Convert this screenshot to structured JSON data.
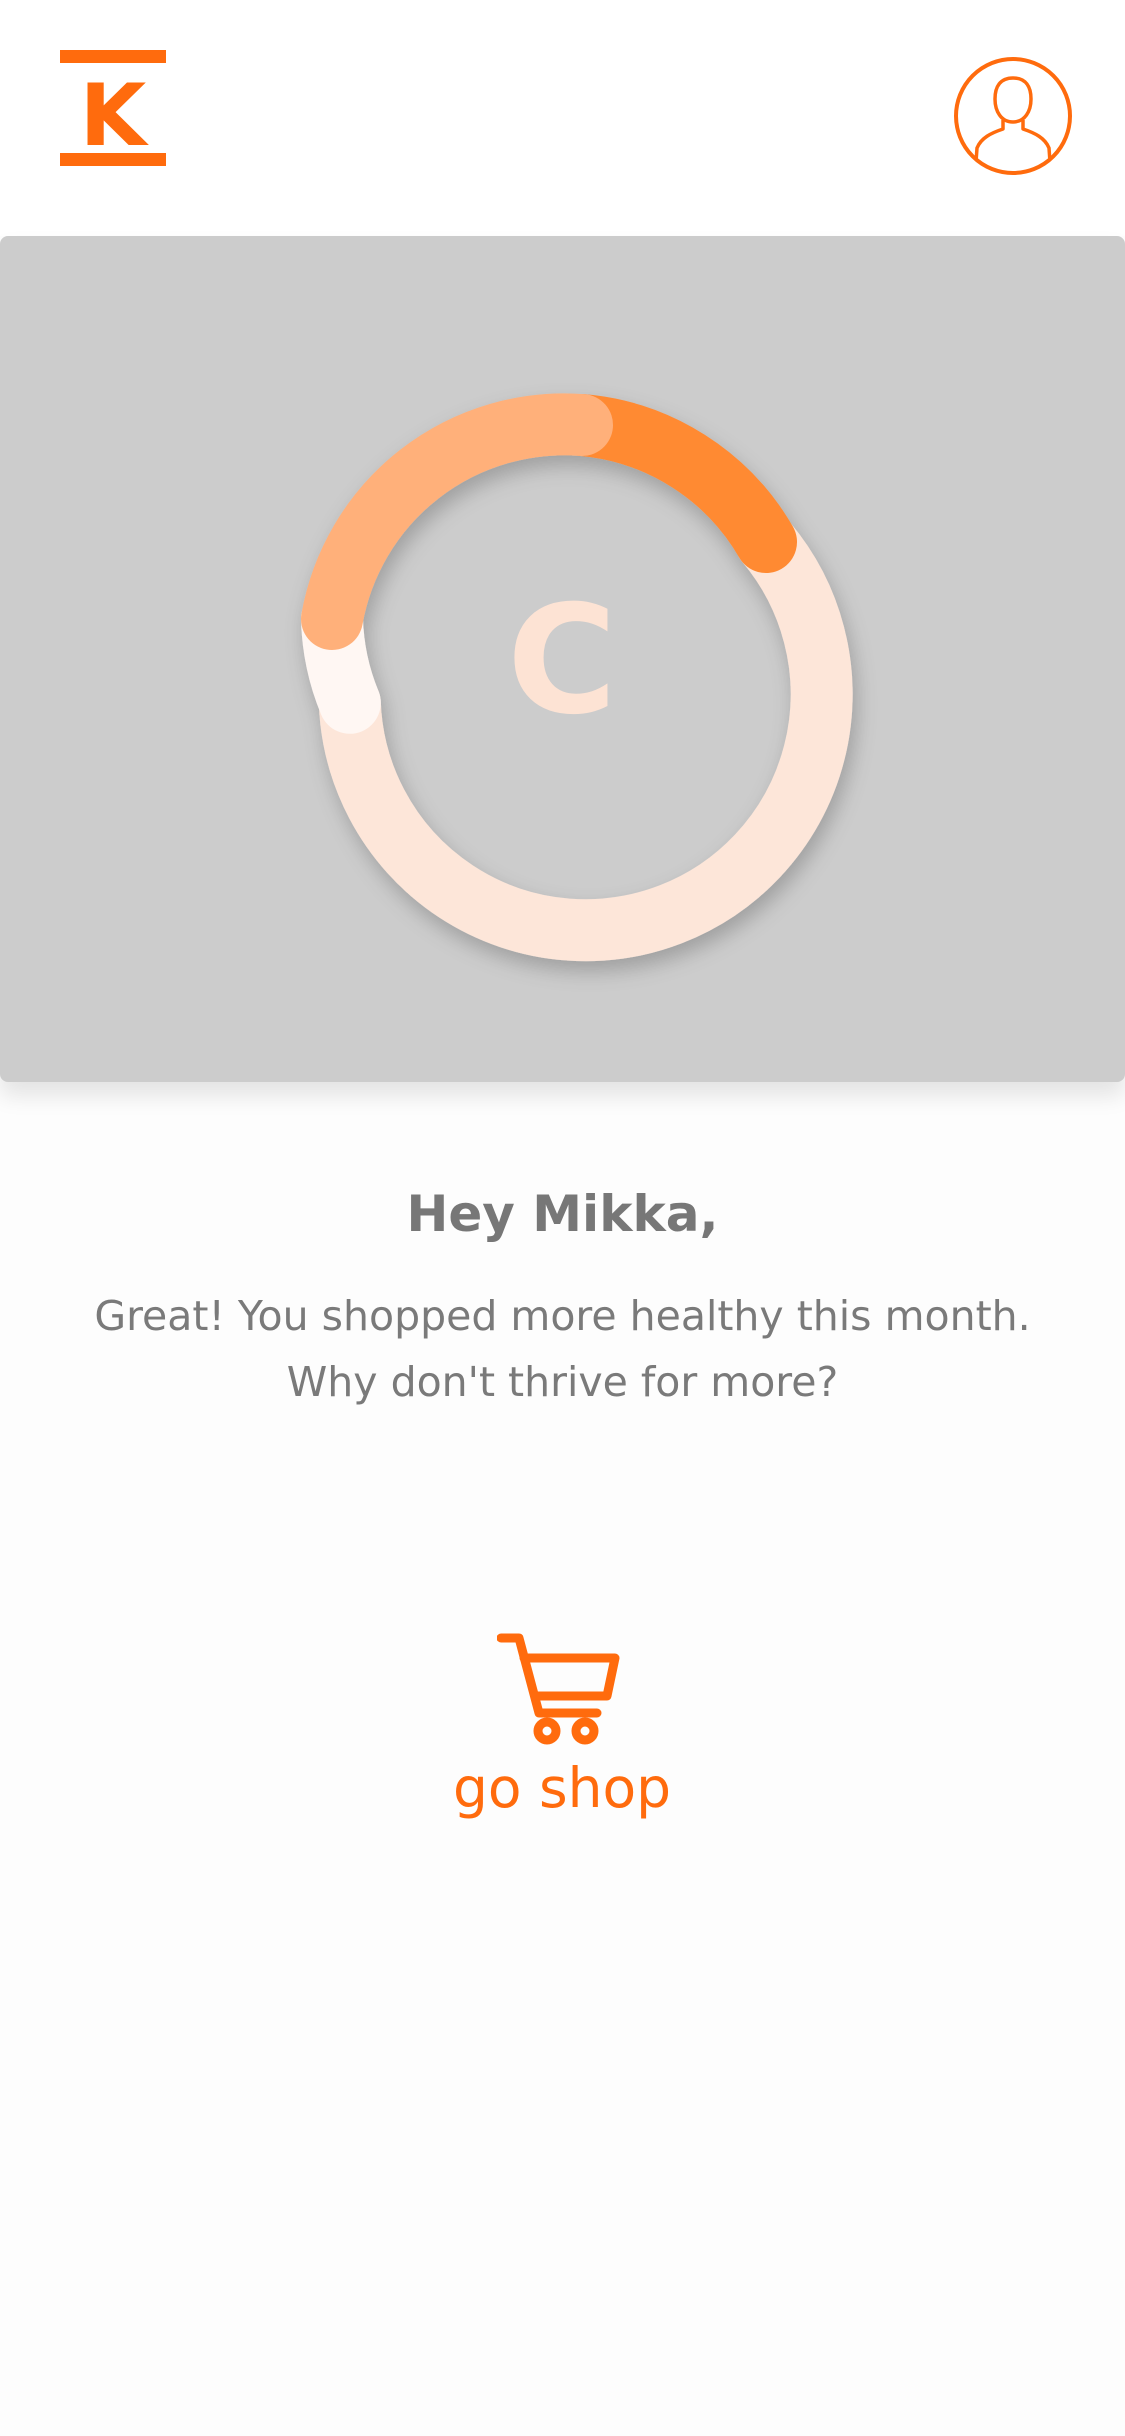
{
  "header": {
    "logo_letter": "K",
    "logo_icon": "k-logo-icon",
    "profile_icon": "user-profile-icon"
  },
  "score": {
    "grade": "C",
    "colors": {
      "accent": "#ff8a33",
      "light_orange": "#ffb07a",
      "peach": "#fde6d9",
      "white_segment": "#fff7f3"
    }
  },
  "greeting": {
    "title": "Hey Mikka,",
    "line1": "Great! You shopped more healthy this month.",
    "line2": "Why don't thrive for more?"
  },
  "action": {
    "label": "go shop",
    "icon": "shopping-cart-icon"
  },
  "colors": {
    "brand": "#ff6b0d",
    "hero_bg": "#cccccc",
    "text": "#777777"
  }
}
